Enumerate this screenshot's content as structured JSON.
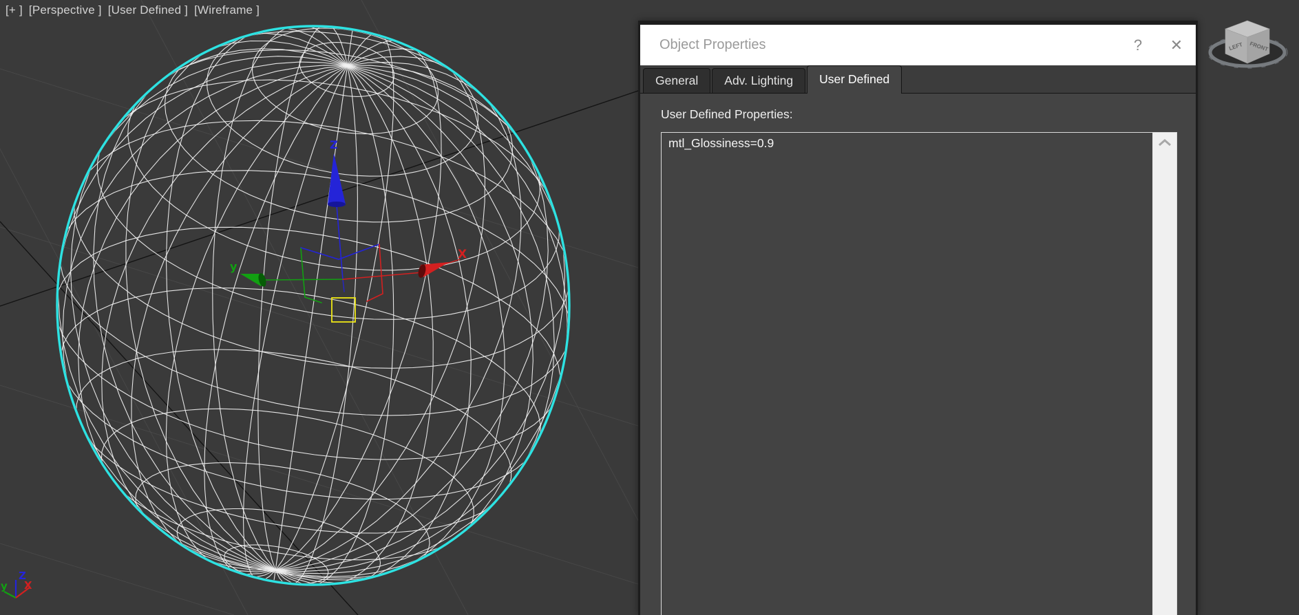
{
  "viewport": {
    "label_segments": [
      "[+ ]",
      "[Perspective ]",
      "[User Defined ]",
      "[Wireframe ]"
    ]
  },
  "dialog": {
    "title": "Object Properties",
    "help_label": "?",
    "close_label": "✕",
    "tabs": [
      {
        "label": "General",
        "active": false
      },
      {
        "label": "Adv. Lighting",
        "active": false
      },
      {
        "label": "User Defined",
        "active": true
      }
    ],
    "user_defined": {
      "label": "User Defined Properties:",
      "text": "mtl_Glossiness=0.9"
    }
  },
  "gizmo": {
    "x_label": "X",
    "y_label": "y",
    "z_label": "Z"
  },
  "axis_tripod": {
    "x_label": "X",
    "y_label": "y",
    "z_label": "Z"
  },
  "viewcube": {
    "left_face": "LEFT",
    "front_face": "FRONT"
  },
  "colors": {
    "viewport_bg": "#3a3a3a",
    "wireframe": "#f2f2f2",
    "selection_outline": "#2de2e2",
    "grid_line": "#4a4a4a",
    "grid_axis": "#141414",
    "axis_x": "#d32020",
    "axis_y": "#12a012",
    "axis_z": "#2424d8",
    "gizmo_select": "#efe716",
    "dialog_bg": "#444444",
    "titlebar_bg": "#ffffff",
    "titlebar_text": "#9a9a9a",
    "scrollbar_bg": "#f0f0f0"
  }
}
